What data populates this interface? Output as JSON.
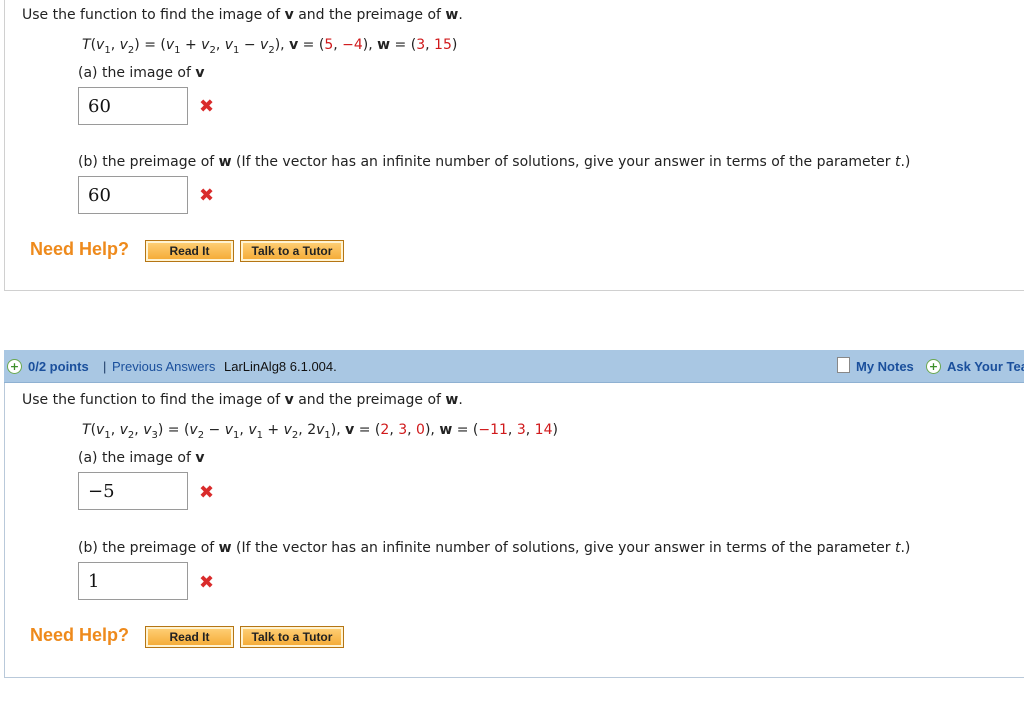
{
  "q1": {
    "intro": "Use the function to find the image of v and the preimage of w.",
    "part_a_label": "(a) the image of v",
    "part_a_answer": "60",
    "part_b_label": "(b) the preimage of w (If the vector has an infinite number of solutions, give your answer in terms of the parameter t.)",
    "part_b_answer": "60",
    "need_help": "Need Help?",
    "read_it": "Read It",
    "talk_tutor": "Talk to a Tutor"
  },
  "q2": {
    "header": {
      "points": "0/2 points",
      "separator": "|",
      "previous_answers": "Previous Answers",
      "source": "LarLinAlg8 6.1.004.",
      "my_notes": "My Notes",
      "ask_teacher": "Ask Your Tea"
    },
    "intro": "Use the function to find the image of v and the preimage of w.",
    "part_a_label": "(a) the image of v",
    "part_a_answer": "−5",
    "part_b_label": "(b) the preimage of w (If the vector has an infinite number of solutions, give your answer in terms of the parameter t.)",
    "part_b_answer": "1",
    "need_help": "Need Help?",
    "read_it": "Read It",
    "talk_tutor": "Talk to a Tutor"
  },
  "colors": {
    "need_help": "#ee8a1c",
    "red_values": "#d0191b",
    "header_bg": "#a9c7e3",
    "link": "#1a4f9c"
  },
  "icons": [
    "x-mark-icon",
    "plus-circle-icon",
    "notes-icon"
  ]
}
